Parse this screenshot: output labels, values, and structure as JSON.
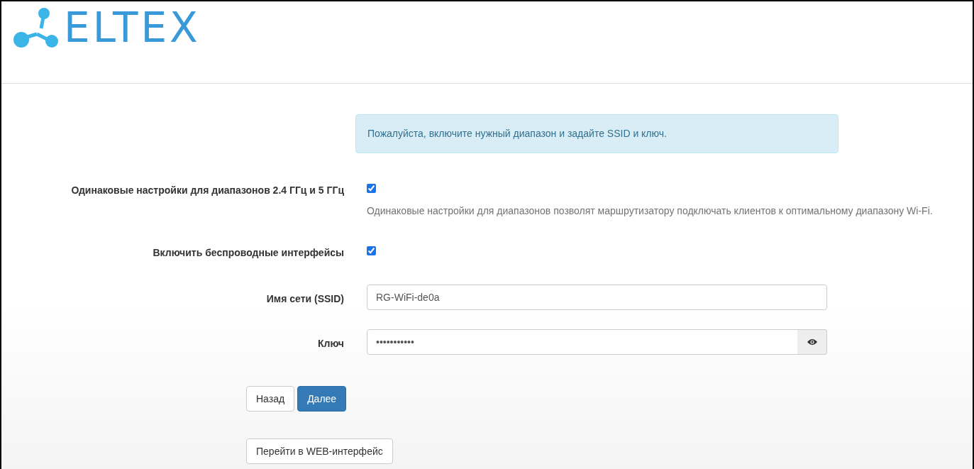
{
  "logo": {
    "text": "ELTEX"
  },
  "alert": {
    "text": "Пожалуйста, включите нужный диапазон и задайте SSID и ключ."
  },
  "fields": [
    {
      "kind": "checkbox",
      "label": "Одинаковые настройки для диапазонов 2.4 ГГц и 5 ГГц",
      "checked": true,
      "help": "Одинаковые настройки для диапазонов позволят маршрутизатору подключать клиентов к оптимальному диапазону Wi-Fi."
    },
    {
      "kind": "checkbox",
      "label": "Включить беспроводные интерфейсы",
      "checked": true
    },
    {
      "kind": "text",
      "label": "Имя сети (SSID)",
      "value": "RG-WiFi-de0a"
    },
    {
      "kind": "password",
      "label": "Ключ",
      "value": "•••••••••••"
    }
  ],
  "buttons": [
    {
      "label": "Назад",
      "primary": false
    },
    {
      "label": "Далее",
      "primary": true
    }
  ],
  "web_button": {
    "label": "Перейти в WEB-интерфейс"
  }
}
